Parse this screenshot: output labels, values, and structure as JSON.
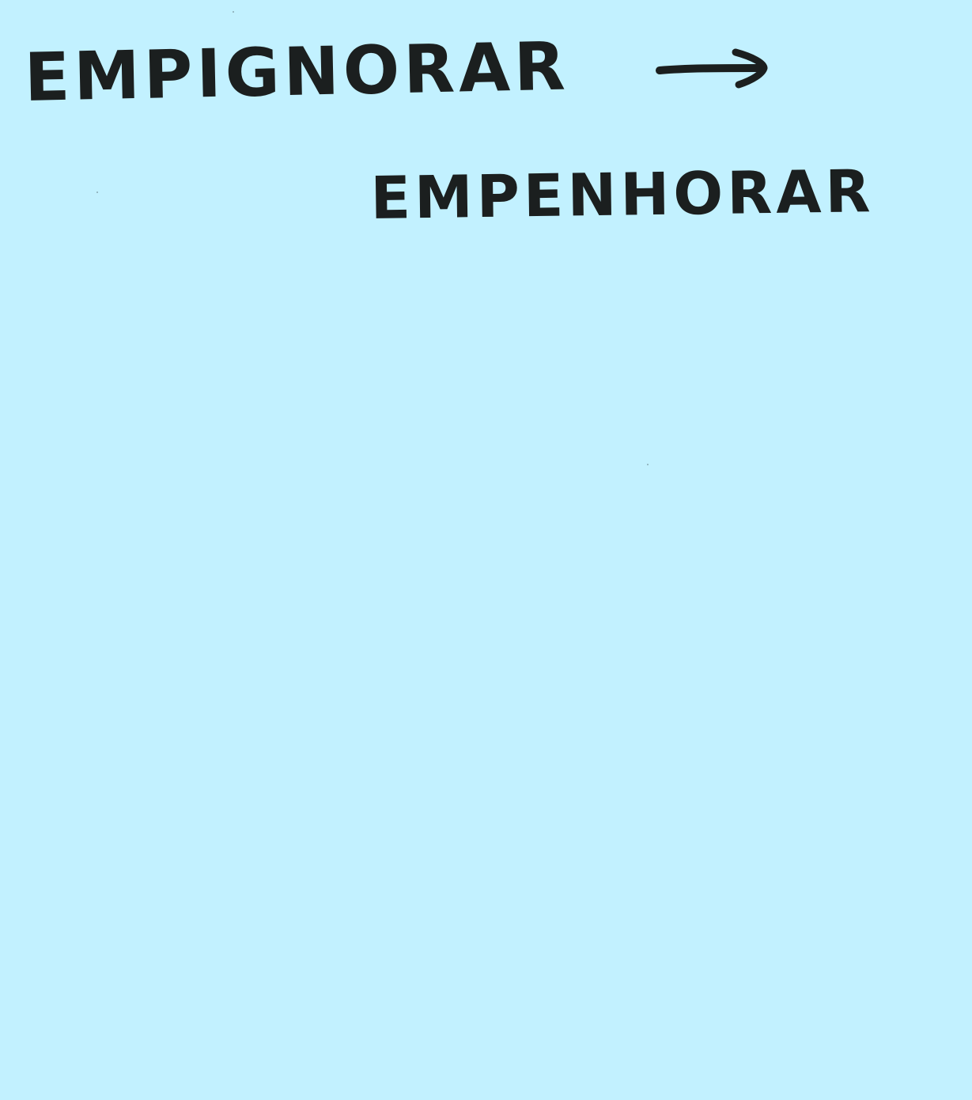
{
  "note": {
    "background_color": "#c2f1ff",
    "ink_color": "#1b1f1f",
    "line_1": "EMPIGNORAR",
    "line_2": "EMPENHORAR",
    "arrow_icon": "right-arrow-icon"
  }
}
